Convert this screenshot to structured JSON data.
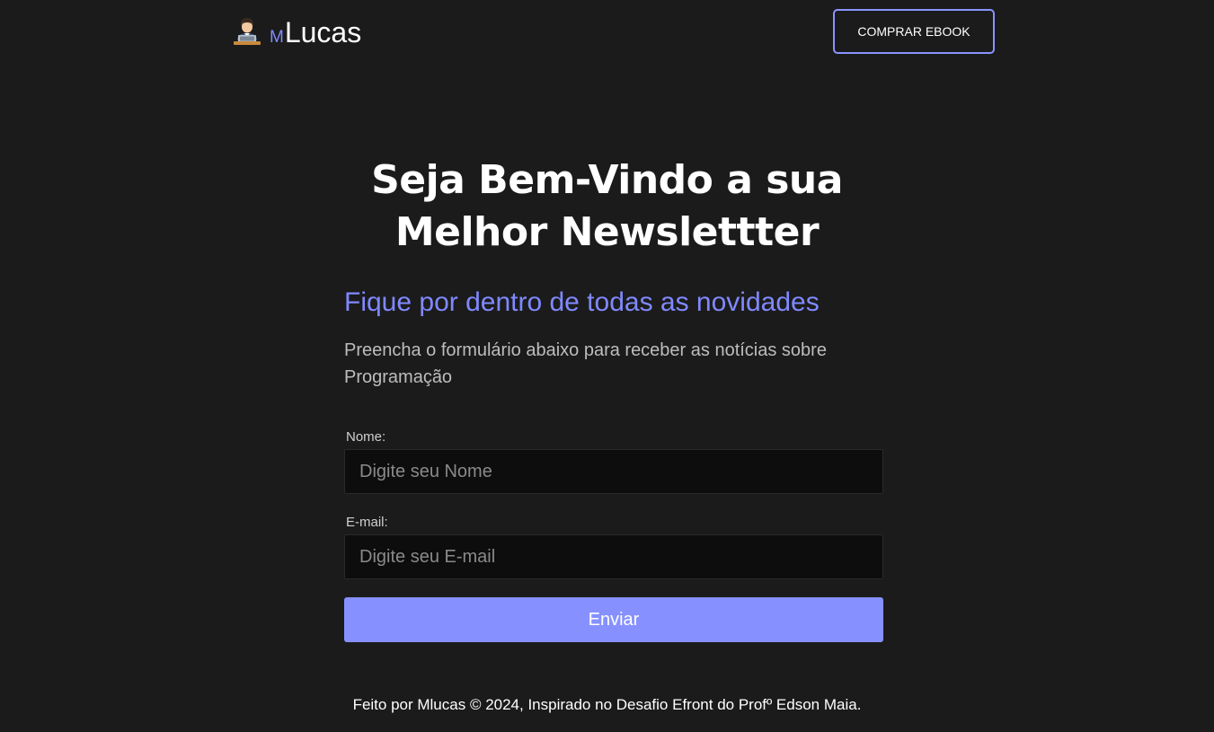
{
  "header": {
    "logo_icon": "technologist-emoji-icon",
    "logo_prefix": "M",
    "logo_name": "Lucas",
    "buy_button_label": "COMPRAR EBOOK"
  },
  "hero": {
    "title_line1": "Seja Bem-Vindo a sua",
    "title_line2": "Melhor Newslettter",
    "subtitle": "Fique por dentro de todas as novidades",
    "description": "Preencha o formulário abaixo para receber as notícias sobre Programação"
  },
  "form": {
    "name_label": "Nome:",
    "name_placeholder": "Digite seu Nome",
    "name_value": "",
    "email_label": "E-mail:",
    "email_placeholder": "Digite seu E-mail",
    "email_value": "",
    "submit_label": "Enviar"
  },
  "footer": {
    "text": "Feito por Mlucas © 2024, Inspirado no Desafio Efront do Profº Edson Maia."
  },
  "colors": {
    "background": "#1b1b1b",
    "accent": "#8691ff",
    "subtitle": "#8089ff",
    "input_background": "#0d0d0d"
  }
}
